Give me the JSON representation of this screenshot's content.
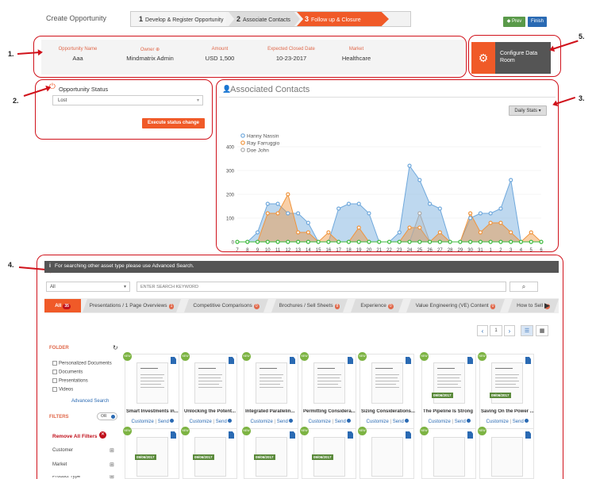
{
  "header": {
    "title": "Create Opportunity",
    "steps": [
      {
        "num": "1",
        "label": "Develop & Register Opportunity"
      },
      {
        "num": "2",
        "label": "Associate Contacts"
      },
      {
        "num": "3",
        "label": "Follow up & Closure"
      }
    ],
    "prev": "◆ Prev",
    "finish": "Finish"
  },
  "annotations": [
    "1.",
    "2.",
    "3.",
    "4.",
    "5."
  ],
  "summary": [
    {
      "label": "Opportunity Name",
      "value": "Aaa"
    },
    {
      "label": "Owner ⊕",
      "value": "Mindmatrix Admin"
    },
    {
      "label": "Amount",
      "value": "USD 1,500"
    },
    {
      "label": "Expected Closed Date",
      "value": "10-23-2017"
    },
    {
      "label": "Market",
      "value": "Healthcare"
    }
  ],
  "configure": {
    "label": "Configure Data Room"
  },
  "status": {
    "title": "Opportunity Status",
    "value": "Lost",
    "execute": "Execute status change"
  },
  "contacts": {
    "title": "Associated Contacts",
    "stats_button": "Daily Stats ▾"
  },
  "chart_data": {
    "type": "area",
    "x": [
      "7",
      "8",
      "9",
      "10",
      "11",
      "12",
      "13",
      "14",
      "15",
      "16",
      "17",
      "18",
      "19",
      "20",
      "21",
      "22",
      "23",
      "24",
      "25",
      "26",
      "27",
      "28",
      "29",
      "30",
      "31",
      "1",
      "2",
      "3",
      "4",
      "5",
      "6"
    ],
    "ylim": [
      0,
      400
    ],
    "yticks": [
      "0",
      "100",
      "200",
      "300",
      "400"
    ],
    "series": [
      {
        "name": "Hanny Nassin",
        "color": "#6fa8dc",
        "values": [
          0,
          0,
          40,
          160,
          160,
          120,
          120,
          80,
          0,
          0,
          140,
          160,
          160,
          120,
          0,
          0,
          40,
          320,
          260,
          160,
          140,
          0,
          0,
          100,
          120,
          120,
          140,
          260,
          0,
          0,
          0
        ]
      },
      {
        "name": "Ray Farruggio",
        "color": "#f0943c",
        "values": [
          0,
          0,
          0,
          120,
          120,
          200,
          40,
          40,
          0,
          40,
          0,
          0,
          60,
          0,
          0,
          0,
          0,
          60,
          60,
          0,
          40,
          0,
          0,
          120,
          40,
          80,
          80,
          40,
          0,
          40,
          0
        ]
      },
      {
        "name": "Doe John",
        "color": "#aaaaaa",
        "values": [
          0,
          0,
          0,
          0,
          0,
          0,
          0,
          0,
          0,
          0,
          0,
          0,
          0,
          0,
          0,
          0,
          0,
          0,
          120,
          0,
          0,
          0,
          0,
          0,
          0,
          0,
          0,
          0,
          0,
          0,
          0
        ]
      },
      {
        "name": "",
        "color": "#3cb93c",
        "values": [
          0,
          0,
          0,
          0,
          0,
          0,
          0,
          0,
          0,
          0,
          0,
          0,
          0,
          0,
          0,
          0,
          0,
          0,
          0,
          0,
          0,
          0,
          0,
          0,
          0,
          0,
          0,
          0,
          0,
          0,
          0
        ]
      }
    ]
  },
  "library": {
    "info": "For searching other asset type please use Advanced Search.",
    "filter_value": "All",
    "search_placeholder": "ENTER SEARCH KEYWORD",
    "tabs": [
      {
        "label": "All",
        "count": "35"
      },
      {
        "label": "Presentations / 1 Page Overviews",
        "count": "1"
      },
      {
        "label": "Competitive Comparisons",
        "count": "0"
      },
      {
        "label": "Brochures / Sell Sheets",
        "count": "8"
      },
      {
        "label": "Experience",
        "count": "0"
      },
      {
        "label": "Value Engineering (VE) Content",
        "count": "0"
      },
      {
        "label": "How to Sell",
        "count": "0"
      }
    ],
    "page": "1",
    "folder_title": "FOLDER",
    "folders": [
      "Personalized Documents",
      "Documents",
      "Presentations",
      "Videos"
    ],
    "advanced": "Advanced Search",
    "filters_title": "FILTERS",
    "filters_toggle": "OR",
    "remove_filters": "Remove All Filters",
    "filter_items": [
      "Customer",
      "Market",
      "Product Type"
    ],
    "cards": [
      {
        "title": "Smart Investments in...",
        "date": ""
      },
      {
        "title": "Unlocking the Potent...",
        "date": ""
      },
      {
        "title": "Integrated Parallelin...",
        "date": ""
      },
      {
        "title": "Permitting Considera...",
        "date": ""
      },
      {
        "title": "Sizing Considerations...",
        "date": ""
      },
      {
        "title": "The Pipeline Is Strong",
        "date": "09/06/2017"
      },
      {
        "title": "Saving On the Power ...",
        "date": "09/06/2017"
      }
    ],
    "card_actions": {
      "customize": "Customize",
      "send": "Send"
    },
    "row2_dates": [
      "09/06/2017",
      "09/06/2017",
      "09/06/2017",
      "09/06/2017",
      "",
      "",
      "",
      ""
    ]
  }
}
